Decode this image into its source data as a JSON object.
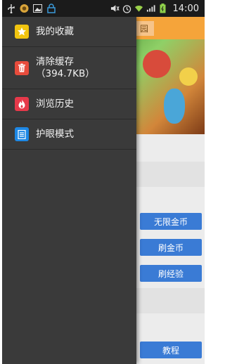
{
  "status_bar": {
    "time": "14:00",
    "left_icons": [
      "usb-icon",
      "app-icon",
      "image-icon",
      "lock-icon"
    ],
    "right_icons": [
      "mute-icon",
      "alarm-icon",
      "wifi-icon",
      "signal-icon",
      "battery-icon"
    ]
  },
  "drawer": {
    "items": [
      {
        "label": "我的收藏",
        "icon": "star-icon",
        "icon_color": "#f1c40f"
      },
      {
        "label": "清除缓存",
        "sub_label": "（394.7KB）",
        "icon": "trash-icon",
        "icon_color": "#e74c3c"
      },
      {
        "label": "浏览历史",
        "icon": "fire-icon",
        "icon_color": "#e6394a"
      },
      {
        "label": "护眼模式",
        "icon": "list-icon",
        "icon_color": "#1e88e5"
      }
    ]
  },
  "background": {
    "header_tab": "园",
    "buttons": [
      "无限金币",
      "刷金币",
      "刷经验",
      "教程"
    ]
  },
  "colors": {
    "drawer_bg": "#3a3a3a",
    "status_bg": "#1b1b1b",
    "bg_button": "#3a7bd5",
    "header_orange": "#f5a43a"
  }
}
